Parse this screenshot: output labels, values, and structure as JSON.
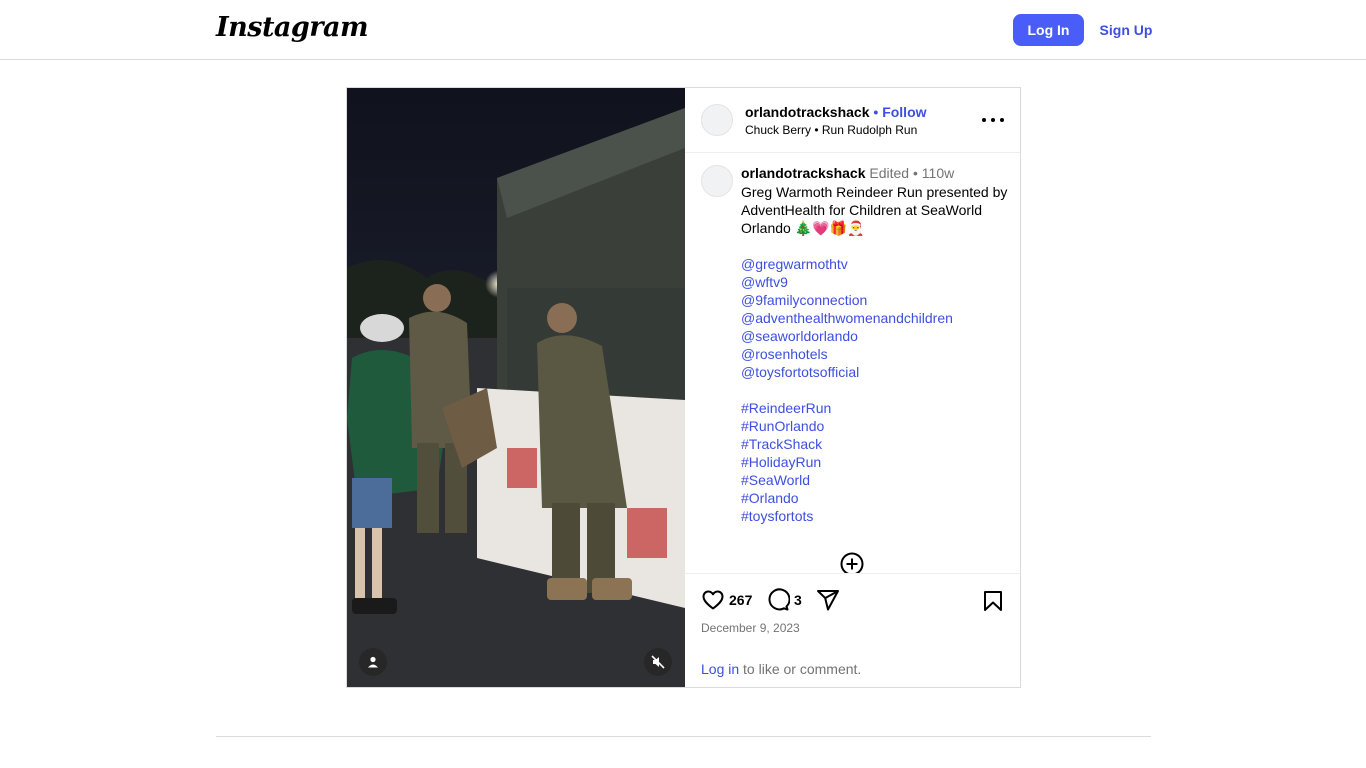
{
  "header": {
    "logo_text": "Instagram",
    "login_label": "Log In",
    "signup_label": "Sign Up"
  },
  "post": {
    "username": "orlandotrackshack",
    "follow_separator": "•",
    "follow_label": "Follow",
    "audio": "Chuck Berry • Run Rudolph Run",
    "caption": {
      "username": "orlandotrackshack",
      "edited": "Edited •",
      "time": "110w",
      "lines": [
        "Greg Warmoth Reindeer Run presented by",
        "AdventHealth for Children at SeaWorld",
        "Orlando 🎄💗🎁🎅"
      ],
      "mentions": [
        "@gregwarmothtv",
        "@wftv9",
        "@9familyconnection",
        "@adventhealthwomenandchildren",
        "@seaworldorlando",
        "@rosenhotels",
        "@toysfortotsofficial"
      ],
      "hashtags": [
        "#ReindeerRun",
        "#RunOrlando",
        "#TrackShack",
        "#HolidayRun",
        "#SeaWorld",
        "#Orlando",
        "#toysfortots"
      ]
    },
    "likes": "267",
    "comments": "3",
    "date": "December 9, 2023",
    "login_prompt": {
      "link": "Log in",
      "rest": " to like or comment."
    }
  },
  "colors": {
    "accent": "#4a5df9",
    "link": "#3d4fe0",
    "border": "#dbdbdb",
    "muted_text": "#737373"
  }
}
